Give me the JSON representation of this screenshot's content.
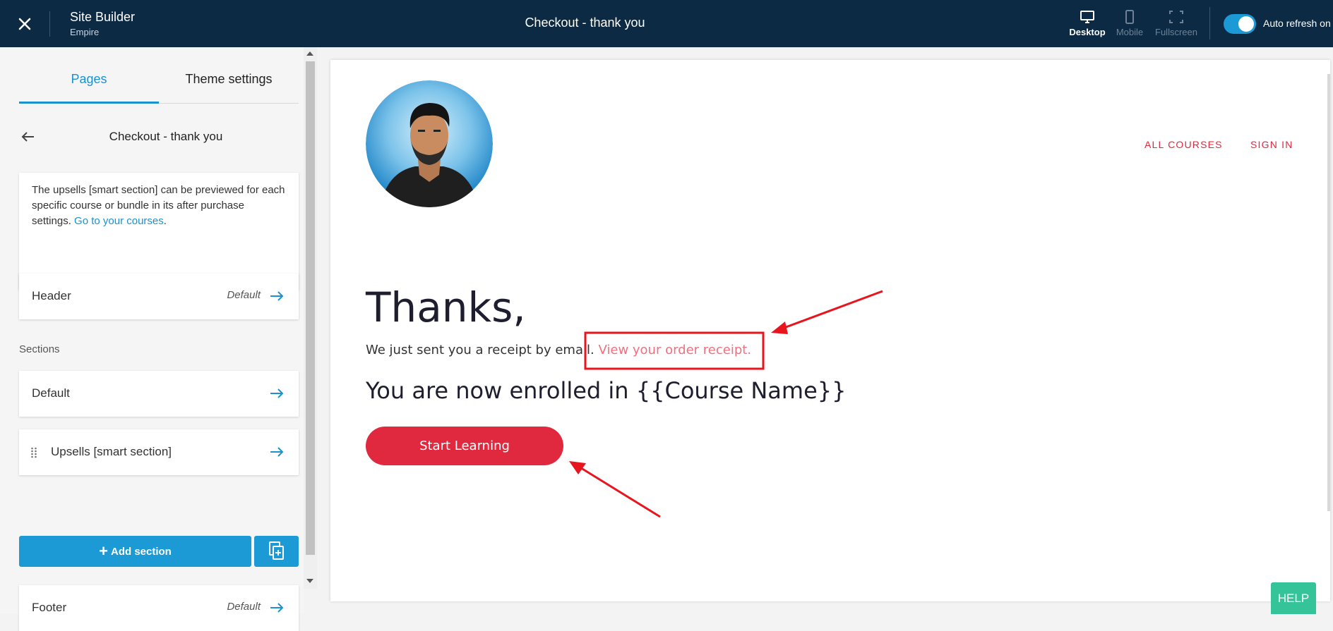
{
  "topbar": {
    "app_title": "Site Builder",
    "app_subtitle": "Empire",
    "page_title": "Checkout - thank you",
    "views": [
      {
        "label": "Desktop",
        "active": true
      },
      {
        "label": "Mobile",
        "active": false
      },
      {
        "label": "Fullscreen",
        "active": false
      }
    ],
    "auto_refresh_label": "Auto refresh on",
    "auto_refresh_on": true
  },
  "sidebar": {
    "tabs": [
      {
        "label": "Pages",
        "active": true
      },
      {
        "label": "Theme settings",
        "active": false
      }
    ],
    "page_title": "Checkout - thank you",
    "info_text": "The upsells [smart section] can be previewed for each specific course or bundle in its after purchase settings.",
    "info_link": "Go to your courses",
    "info_after_link": ".",
    "header_card": {
      "name": "Header",
      "meta": "Default"
    },
    "sections_label": "Sections",
    "sections": [
      {
        "name": "Default"
      },
      {
        "name": "Upsells [smart section]"
      }
    ],
    "add_section_label": "Add section",
    "footer_card": {
      "name": "Footer",
      "meta": "Default"
    }
  },
  "preview": {
    "nav": [
      "ALL COURSES",
      "SIGN IN"
    ],
    "thanks": "Thanks,",
    "receipt_text": "We just sent you a receipt by email.",
    "receipt_link": "View your order receipt.",
    "enrolled_text": "You are now enrolled in {{Course Name}}",
    "start_button": "Start Learning"
  },
  "help_label": "HELP",
  "colors": {
    "topbar_bg": "#0c2a44",
    "accent_blue": "#1c91d0",
    "brand_red": "#e0283e",
    "receipt_link": "#f07080",
    "annotation_red": "#e8141e",
    "help_green": "#35c49a"
  }
}
